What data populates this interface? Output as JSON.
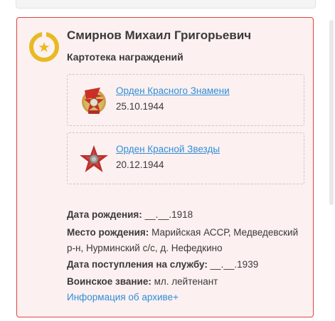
{
  "person": {
    "name": "Смирнов Михаил Григорьевич",
    "card_title": "Картотека награждений"
  },
  "awards": [
    {
      "name": "Орден Красного Знамени",
      "date": "25.10.1944",
      "icon": "order-red-banner-icon"
    },
    {
      "name": "Орден Красной Звезды",
      "date": "20.12.1944",
      "icon": "order-red-star-icon"
    }
  ],
  "details": {
    "birth_date_label": "Дата рождения:",
    "birth_date_value": "__.__.1918",
    "birth_place_label": "Место рождения:",
    "birth_place_value": "Марийская АССР, Медведевский р-н, Нурминский с/с, д. Нефедкино",
    "service_date_label": "Дата поступления на службу:",
    "service_date_value": "__.__.1939",
    "rank_label": "Воинское звание:",
    "rank_value": "мл. лейтенант"
  },
  "archive_link": "Информация об архиве+",
  "colors": {
    "accent_border": "#d9453f",
    "card_bg": "#fdf0f0",
    "link": "#2f8fd8",
    "medal_gold": "#e8b923"
  }
}
